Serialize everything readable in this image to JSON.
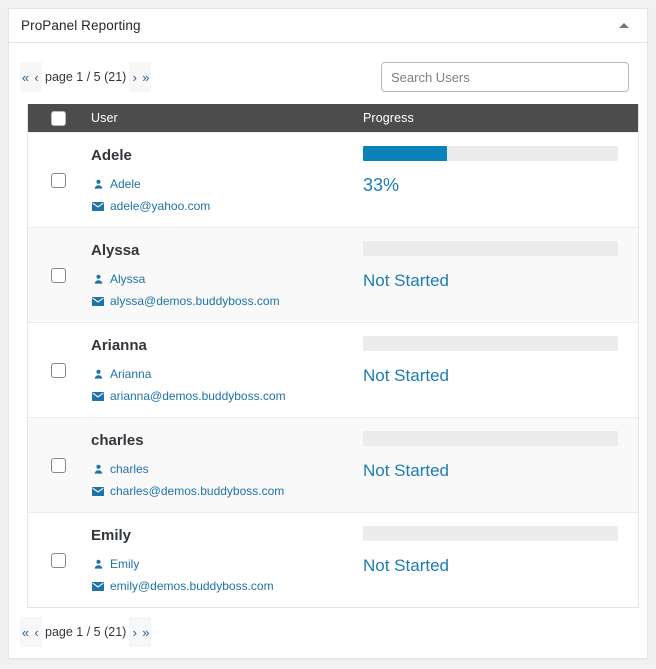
{
  "panel": {
    "title": "ProPanel Reporting",
    "collapse_icon": "caret-up-icon"
  },
  "pagination": {
    "first_label": "«",
    "prev_label": "‹",
    "page_label": "page 1 / 5 (21)",
    "next_label": "›",
    "last_label": "»",
    "current_page": 1,
    "total_pages": 5,
    "total_items": 21
  },
  "search": {
    "value": "",
    "placeholder": "Search Users"
  },
  "table": {
    "columns": {
      "user": "User",
      "progress": "Progress"
    },
    "rows": [
      {
        "name": "Adele",
        "username": "Adele",
        "email": "adele@yahoo.com",
        "progress_value": 33,
        "progress_label": "33%",
        "progress_width": "33%"
      },
      {
        "name": "Alyssa",
        "username": "Alyssa",
        "email": "alyssa@demos.buddyboss.com",
        "progress_value": 0,
        "progress_label": "Not Started",
        "progress_width": "0%"
      },
      {
        "name": "Arianna",
        "username": "Arianna",
        "email": "arianna@demos.buddyboss.com",
        "progress_value": 0,
        "progress_label": "Not Started",
        "progress_width": "0%"
      },
      {
        "name": "charles",
        "username": "charles",
        "email": "charles@demos.buddyboss.com",
        "progress_value": 0,
        "progress_label": "Not Started",
        "progress_width": "0%"
      },
      {
        "name": "Emily",
        "username": "Emily",
        "email": "emily@demos.buddyboss.com",
        "progress_value": 0,
        "progress_label": "Not Started",
        "progress_width": "0%"
      }
    ]
  },
  "colors": {
    "header_bg": "#4c4c4c",
    "progress_fill": "#0c82ba",
    "progress_track": "#ececec",
    "link": "#1e73a8"
  }
}
